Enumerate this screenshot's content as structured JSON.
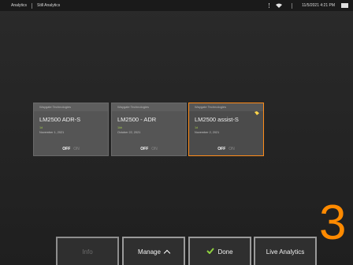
{
  "statusbar": {
    "crumb1": "Analytics",
    "crumb2": "Still Analytics",
    "datetime": "11/5/2021  4:21 PM"
  },
  "cards": [
    {
      "header": "Waygate Technologies",
      "title": "LM2500 ADR-S",
      "num": "1d",
      "date": "November 1, 2021",
      "off": "OFF",
      "on": "ON"
    },
    {
      "header": "Waygate Technologies",
      "title": "LM2500 - ADR",
      "num": "1kb",
      "date": "October 22, 2021",
      "off": "OFF",
      "on": "ON"
    },
    {
      "header": "Waygate Technologies",
      "title": "LM2500 assist-S",
      "num": "1d",
      "date": "November 2, 2021",
      "off": "OFF",
      "on": "ON"
    }
  ],
  "buttons": {
    "info": "Info",
    "manage": "Manage",
    "done": "Done",
    "live": "Live Analytics"
  },
  "callout_number": "3",
  "colors": {
    "accent": "#ff8c1a",
    "check": "#8fd13f"
  }
}
